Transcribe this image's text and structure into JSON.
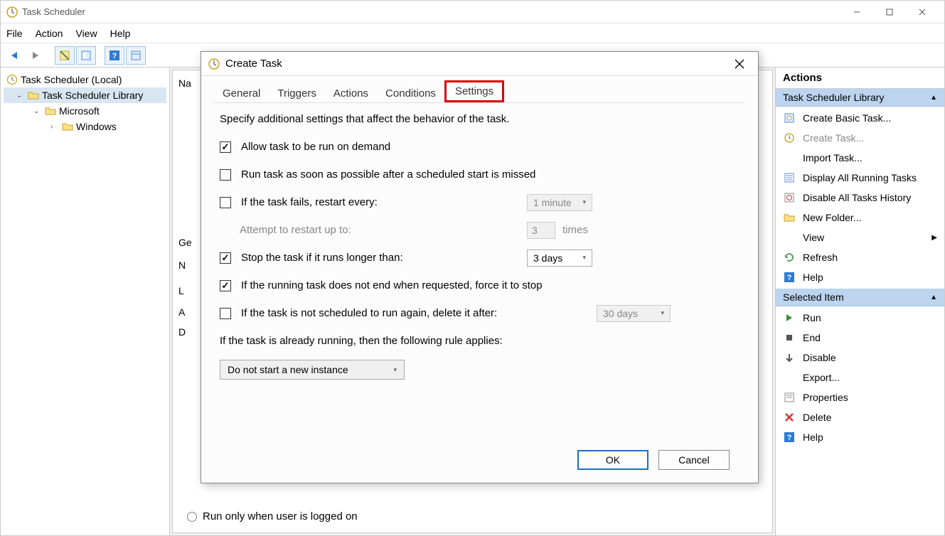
{
  "app": {
    "title": "Task Scheduler",
    "menus": [
      "File",
      "Action",
      "View",
      "Help"
    ]
  },
  "tree": {
    "root": "Task Scheduler (Local)",
    "library": "Task Scheduler Library",
    "microsoft": "Microsoft",
    "windows": "Windows"
  },
  "center": {
    "na_prefix": "Na",
    "ge_prefix": "Ge",
    "letters": [
      "N",
      "L",
      "A",
      "D"
    ],
    "radio_label": "Run only when user is logged on"
  },
  "actions": {
    "header": "Actions",
    "section1": "Task Scheduler Library",
    "items1": [
      {
        "label": "Create Basic Task...",
        "icon": "wizard"
      },
      {
        "label": "Create Task...",
        "icon": "clock",
        "disabled": true
      },
      {
        "label": "Import Task...",
        "icon": "none"
      },
      {
        "label": "Display All Running Tasks",
        "icon": "list"
      },
      {
        "label": "Disable All Tasks History",
        "icon": "history"
      },
      {
        "label": "New Folder...",
        "icon": "folder"
      },
      {
        "label": "View",
        "icon": "none",
        "chevron": true
      },
      {
        "label": "Refresh",
        "icon": "refresh"
      },
      {
        "label": "Help",
        "icon": "help"
      }
    ],
    "section2": "Selected Item",
    "items2": [
      {
        "label": "Run",
        "icon": "play"
      },
      {
        "label": "End",
        "icon": "stop"
      },
      {
        "label": "Disable",
        "icon": "disable"
      },
      {
        "label": "Export...",
        "icon": "none"
      },
      {
        "label": "Properties",
        "icon": "props"
      },
      {
        "label": "Delete",
        "icon": "delete"
      },
      {
        "label": "Help",
        "icon": "help"
      }
    ]
  },
  "dialog": {
    "title": "Create Task",
    "tabs": [
      "General",
      "Triggers",
      "Actions",
      "Conditions",
      "Settings"
    ],
    "active_tab": "Settings",
    "desc": "Specify additional settings that affect the behavior of the task.",
    "allow_on_demand": {
      "label": "Allow task to be run on demand",
      "checked": true
    },
    "run_asap": {
      "label": "Run task as soon as possible after a scheduled start is missed",
      "checked": false
    },
    "restart_every": {
      "label": "If the task fails, restart every:",
      "checked": false,
      "value": "1 minute"
    },
    "attempt_label": "Attempt to restart up to:",
    "attempt_count": "3",
    "attempt_times": "times",
    "stop_longer": {
      "label": "Stop the task if it runs longer than:",
      "checked": true,
      "value": "3 days"
    },
    "force_stop": {
      "label": "If the running task does not end when requested, force it to stop",
      "checked": true
    },
    "delete_after": {
      "label": "If the task is not scheduled to run again, delete it after:",
      "checked": false,
      "value": "30 days"
    },
    "rule_label": "If the task is already running, then the following rule applies:",
    "rule_value": "Do not start a new instance",
    "ok": "OK",
    "cancel": "Cancel"
  }
}
